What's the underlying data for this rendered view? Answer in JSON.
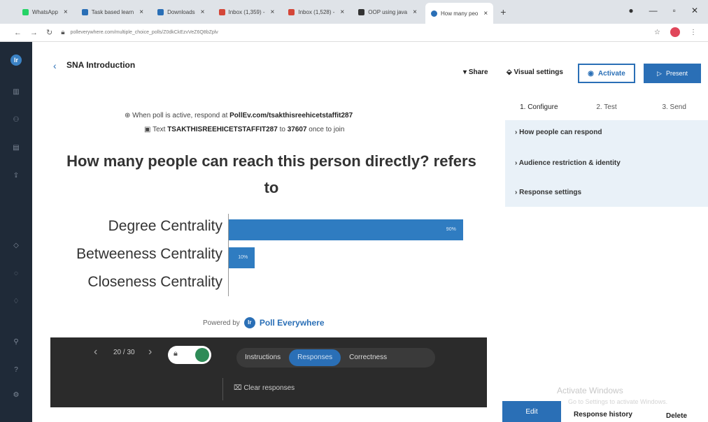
{
  "browser": {
    "tabs": [
      {
        "label": "WhatsApp",
        "color": "#25d366"
      },
      {
        "label": "Task based learn",
        "color": "#2a6fb6"
      },
      {
        "label": "Downloads",
        "color": "#2a6fb6"
      },
      {
        "label": "Inbox (1,359) - ",
        "color": "#d44638"
      },
      {
        "label": "Inbox (1,528) - ",
        "color": "#d44638"
      },
      {
        "label": "OOP using java",
        "color": "#333333"
      },
      {
        "label": "How many peo",
        "color": "#2a6fb6"
      }
    ],
    "new_tab": "+",
    "url": "polleverywhere.com/multiple_choice_polls/Z0dkCkEzvVeZ6Q8bZplv"
  },
  "header": {
    "back_icon": "‹",
    "title": "SNA Introduction",
    "share": "Share",
    "visual_settings": "Visual settings",
    "activate": "Activate",
    "present": "Present"
  },
  "poll": {
    "respond_prefix": "When poll is active, respond at",
    "respond_url": "PollEv.com/tsakthisreehicetstaffit287",
    "text_prefix": "Text",
    "text_code": "TSAKTHISREEHICETSTAFFIT287",
    "text_mid": "to",
    "text_number": "37607",
    "text_suffix": "once to join",
    "question": "How many people can reach this person directly? refers to",
    "powered_by": "Powered by",
    "brand": "Poll Everywhere"
  },
  "chart_data": {
    "type": "bar",
    "categories": [
      "Degree Centrality",
      "Betweeness Centrality",
      "Closeness Centrality"
    ],
    "values": [
      90,
      10,
      0
    ],
    "value_labels": [
      "90%",
      "10%",
      ""
    ],
    "xlim": [
      0,
      100
    ]
  },
  "controls": {
    "prev": "‹",
    "counter": "20 / 30",
    "next": "›",
    "tabs": [
      "Instructions",
      "Responses",
      "Correctness"
    ],
    "active_tab": "Responses",
    "clear": "Clear responses"
  },
  "right_panel": {
    "steps": [
      "1. Configure",
      "2. Test",
      "3. Send"
    ],
    "sections": [
      "How people can respond",
      "Audience restriction & identity",
      "Response settings"
    ]
  },
  "footer": {
    "activate_windows": "Activate Windows",
    "activate_windows_sub": "Go to Settings to activate Windows.",
    "edit": "Edit",
    "history": "Response history",
    "delete": "Delete"
  },
  "colors": {
    "accent": "#2a6fb6",
    "bar": "#2f7cc1",
    "sidebar": "#1f2a38",
    "panel": "#e9f1f8"
  }
}
